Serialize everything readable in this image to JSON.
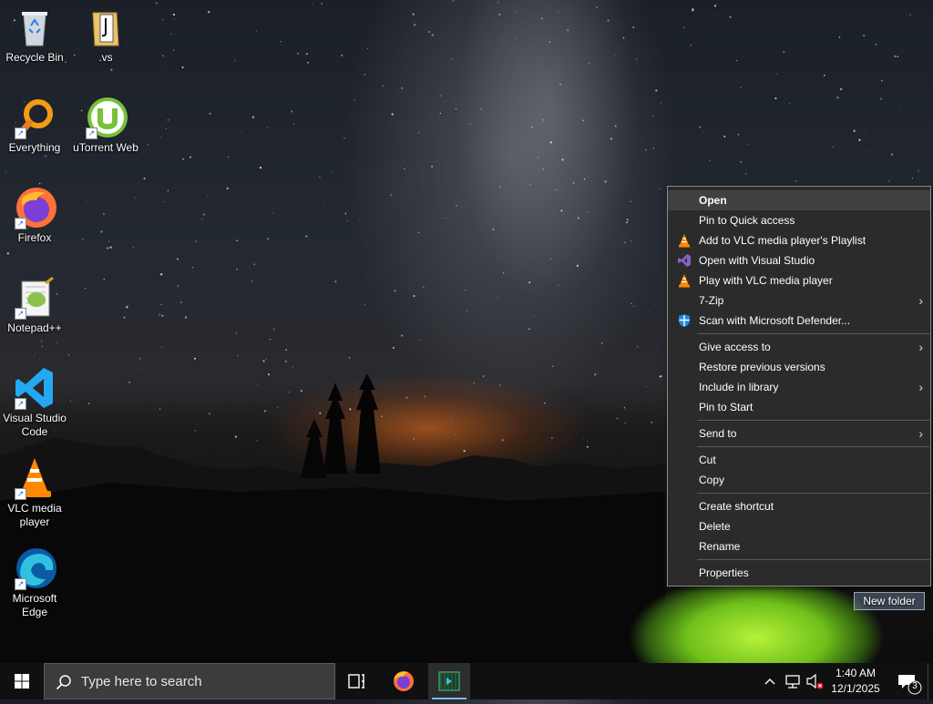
{
  "desktop": {
    "icons": [
      {
        "label": "Recycle Bin",
        "icon": "recycle-bin-icon"
      },
      {
        "label": ".vs",
        "icon": "folder-icon"
      },
      {
        "label": "Everything",
        "icon": "everything-search-icon"
      },
      {
        "label": "uTorrent Web",
        "icon": "utorrent-icon"
      },
      {
        "label": "Firefox",
        "icon": "firefox-icon"
      },
      {
        "label": "Notepad++",
        "icon": "notepad-plus-plus-icon"
      },
      {
        "label": "Visual Studio Code",
        "icon": "vscode-icon"
      },
      {
        "label": "VLC media player",
        "icon": "vlc-icon"
      },
      {
        "label": "Microsoft Edge",
        "icon": "edge-icon"
      }
    ],
    "rename_box": {
      "label": "New folder"
    }
  },
  "context_menu": {
    "items": [
      {
        "label": "Open",
        "highlighted": true,
        "bold": true
      },
      {
        "label": "Pin to Quick access"
      },
      {
        "label": "Add to VLC media player's Playlist",
        "icon": "vlc-icon"
      },
      {
        "label": "Open with Visual Studio",
        "icon": "visual-studio-icon"
      },
      {
        "label": "Play with VLC media player",
        "icon": "vlc-icon"
      },
      {
        "label": "7-Zip",
        "submenu": true
      },
      {
        "label": "Scan with Microsoft Defender...",
        "icon": "defender-shield-icon"
      },
      {
        "label": "Give access to",
        "submenu": true
      },
      {
        "label": "Restore previous versions"
      },
      {
        "label": "Include in library",
        "submenu": true
      },
      {
        "label": "Pin to Start"
      },
      {
        "label": "Send to",
        "submenu": true
      },
      {
        "label": "Cut"
      },
      {
        "label": "Copy"
      },
      {
        "label": "Create shortcut"
      },
      {
        "label": "Delete"
      },
      {
        "label": "Rename"
      },
      {
        "label": "Properties"
      }
    ],
    "submenu_arrow": "›"
  },
  "taskbar": {
    "search_placeholder": "Type here to search",
    "clock_time": "1:40 AM",
    "clock_date": "12/1/2025",
    "notification_count": "3",
    "colors": {
      "background": "#101010",
      "active_indicator": "#7ab8ff"
    }
  }
}
